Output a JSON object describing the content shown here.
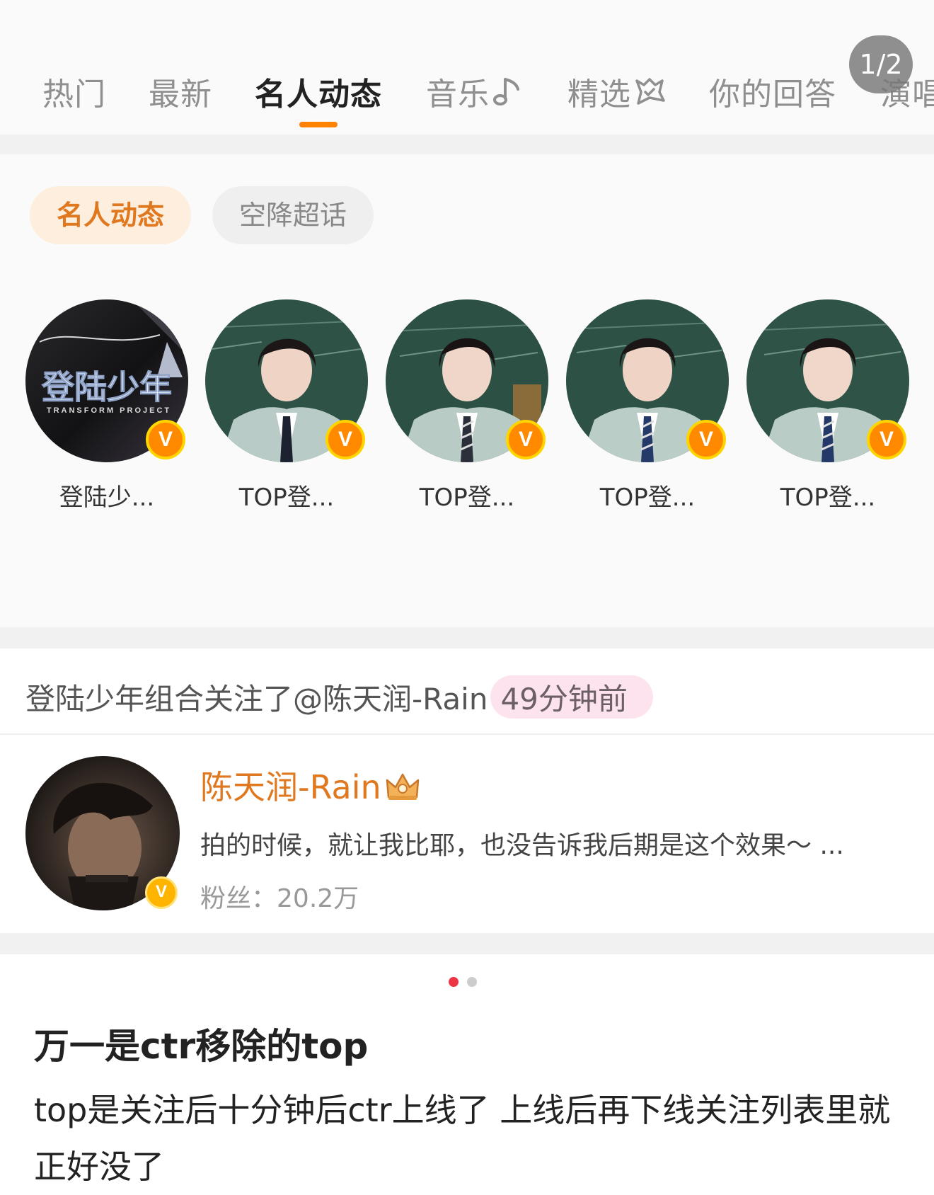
{
  "tabs": [
    {
      "label": "热门",
      "active": false
    },
    {
      "label": "最新",
      "active": false
    },
    {
      "label": "名人动态",
      "active": true
    },
    {
      "label": "音乐",
      "active": false,
      "icon": "music-note-icon"
    },
    {
      "label": "精选",
      "active": false,
      "icon": "star-cat-icon"
    },
    {
      "label": "你的回答",
      "active": false
    },
    {
      "label": "演唱",
      "active": false
    }
  ],
  "page_indicator": "1/2",
  "filters": [
    {
      "label": "名人动态",
      "active": true
    },
    {
      "label": "空降超话",
      "active": false
    }
  ],
  "avatars": [
    {
      "name": "登陆少...",
      "verified": true
    },
    {
      "name": "TOP登...",
      "verified": true
    },
    {
      "name": "TOP登...",
      "verified": true
    },
    {
      "name": "TOP登...",
      "verified": true
    },
    {
      "name": "TOP登...",
      "verified": true
    }
  ],
  "logo_text": {
    "main": "登陆少年",
    "sub": "TRANSFORM PROJECT"
  },
  "activity": {
    "text": "登陆少年组合关注了@陈天润-Rain",
    "time": "49分钟前"
  },
  "user_card": {
    "name": "陈天润-Rain",
    "description": "拍的时候，就让我比耶，也没告诉我后期是这个效果～ ...",
    "fans_label": "粉丝：",
    "fans_count": "20.2万",
    "badge_icon": "crown-icon",
    "verified": true
  },
  "carousel": {
    "count": 2,
    "active_index": 0
  },
  "post": {
    "title": "万一是ctr移除的top",
    "body": "top是关注后十分钟后ctr上线了 上线后再下线关注列表里就正好没了"
  },
  "colors": {
    "accent": "#ff8200",
    "filter_active_bg": "#fdeedd",
    "filter_active_text": "#e0781f",
    "time_badge_bg": "#fde3ee",
    "dot_active": "#ee3344",
    "dot_inactive": "#cccccc"
  }
}
